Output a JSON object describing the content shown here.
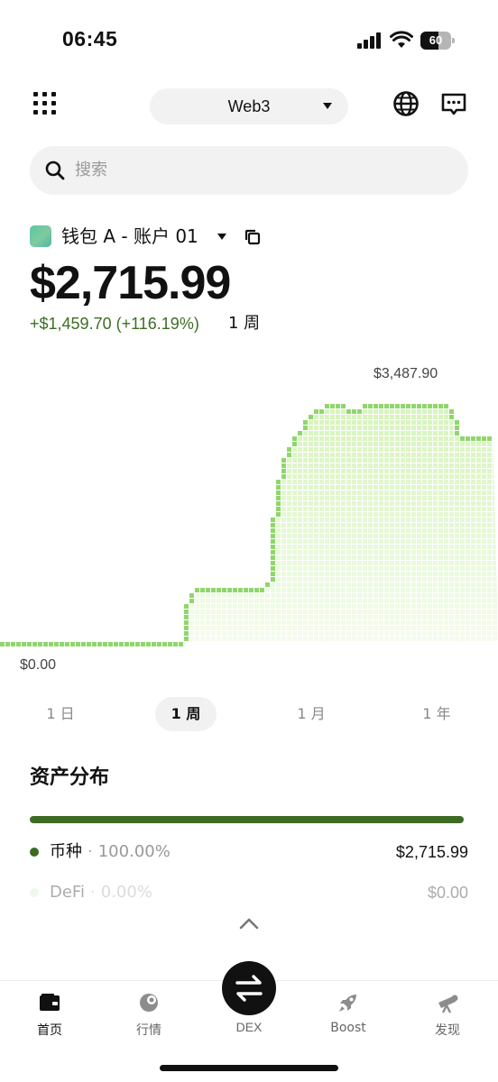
{
  "status": {
    "time": "06:45",
    "battery": "60",
    "battery_level": 0.6
  },
  "header": {
    "network": "Web3"
  },
  "search": {
    "placeholder": "搜索"
  },
  "account": {
    "name": "钱包 A - 账户 01",
    "balance": "$2,715.99",
    "change": "+$1,459.70 (+116.19%)",
    "period": "1 周"
  },
  "chart": {
    "max_label": "$3,487.90",
    "min_label": "$0.00"
  },
  "chart_data": {
    "type": "area",
    "title": "",
    "x": [
      0,
      1,
      2,
      3,
      4,
      5,
      6,
      7,
      8,
      9,
      10,
      11,
      12,
      13,
      14,
      15,
      16,
      17,
      18,
      19,
      20,
      21,
      22,
      23,
      24,
      25,
      26,
      27,
      28,
      29,
      30,
      31,
      32,
      33,
      34,
      35,
      36,
      37,
      38,
      39,
      40,
      41,
      42,
      43,
      44,
      45,
      46,
      47,
      48,
      49,
      50,
      51,
      52,
      53,
      54,
      55,
      56,
      57,
      58,
      59,
      60,
      61,
      62,
      63,
      64,
      65,
      66,
      67,
      68,
      69,
      70,
      71,
      72,
      73,
      74,
      75,
      76,
      77,
      78,
      79,
      80,
      81,
      82,
      83,
      84,
      85,
      86,
      87,
      88,
      89,
      90
    ],
    "values": [
      0,
      0,
      0,
      0,
      0,
      0,
      0,
      0,
      0,
      0,
      0,
      0,
      0,
      0,
      0,
      0,
      0,
      0,
      0,
      0,
      0,
      0,
      0,
      0,
      0,
      0,
      0,
      0,
      0,
      0,
      0,
      0,
      0,
      0,
      580,
      680,
      760,
      780,
      780,
      780,
      780,
      780,
      780,
      820,
      820,
      820,
      820,
      820,
      820,
      850,
      1800,
      2380,
      2680,
      2850,
      3000,
      3150,
      3250,
      3350,
      3420,
      3420,
      3487.9,
      3487.9,
      3487.9,
      3487.9,
      3420,
      3420,
      3450,
      3487.9,
      3487.9,
      3487.9,
      3487.9,
      3487.9,
      3487.9,
      3487.9,
      3487.9,
      3487.9,
      3487.9,
      3487.9,
      3487.9,
      3487.9,
      3487.9,
      3487.9,
      3487.9,
      3350,
      3100,
      3050,
      3050,
      3050,
      3050,
      3050,
      3050
    ],
    "ylim": [
      0,
      3487.9
    ],
    "grid": false,
    "color": "#8fd66b"
  },
  "periods": [
    {
      "label": "1 日",
      "active": false
    },
    {
      "label": "1 周",
      "active": true
    },
    {
      "label": "1 月",
      "active": false
    },
    {
      "label": "1 年",
      "active": false
    }
  ],
  "distribution": {
    "title": "资产分布",
    "items": [
      {
        "name": "币种",
        "pct": "100.00%",
        "value": "$2,715.99",
        "color": "#3e6b24"
      },
      {
        "name": "DeFi",
        "pct": "0.00%",
        "value": "$0.00",
        "color": "#d6efc3"
      }
    ]
  },
  "nav": {
    "home": "首页",
    "market": "行情",
    "dex": "DEX",
    "boost": "Boost",
    "discover": "发现"
  }
}
